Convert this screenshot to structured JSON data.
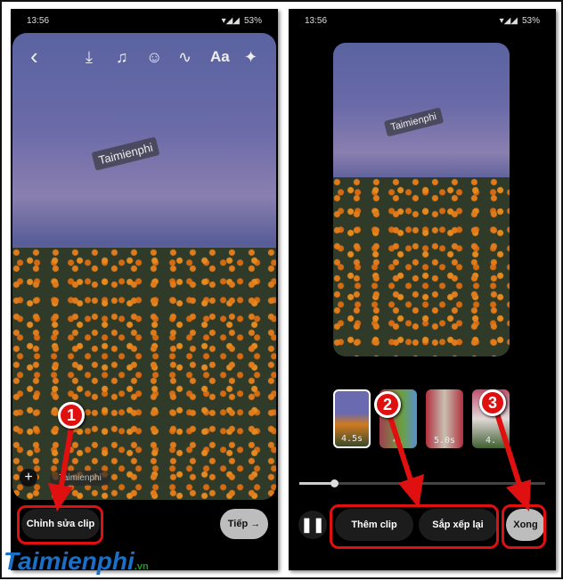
{
  "left": {
    "status": {
      "time": "13:56",
      "battery": "53%"
    },
    "toolbar": {
      "back": "‹",
      "icons": [
        "download-icon",
        "music-icon",
        "sticker-icon",
        "draw-icon",
        "text-icon",
        "effects-icon"
      ],
      "text_label": "Aa"
    },
    "watermark": "Taimienphi",
    "mention_tag": "Taimienphi",
    "edit_clip_label": "Chỉnh sửa clip",
    "next_label": "Tiếp",
    "step": "1"
  },
  "right": {
    "status": {
      "time": "13:56",
      "battery": "53%"
    },
    "watermark": "Taimienphi",
    "clips": [
      {
        "duration": "4.5s"
      },
      {
        "duration": "4."
      },
      {
        "duration": "5.0s"
      },
      {
        "duration": "4."
      }
    ],
    "progress": 0.14,
    "add_clip_label": "Thêm clip",
    "reorder_label": "Sắp xếp lại",
    "done_label": "Xong",
    "steps": [
      "2",
      "3"
    ]
  },
  "logo": {
    "name": "Taimienphi",
    "suffix": ".vn"
  },
  "colors": {
    "annotation": "#e01010",
    "background": "#000000"
  }
}
